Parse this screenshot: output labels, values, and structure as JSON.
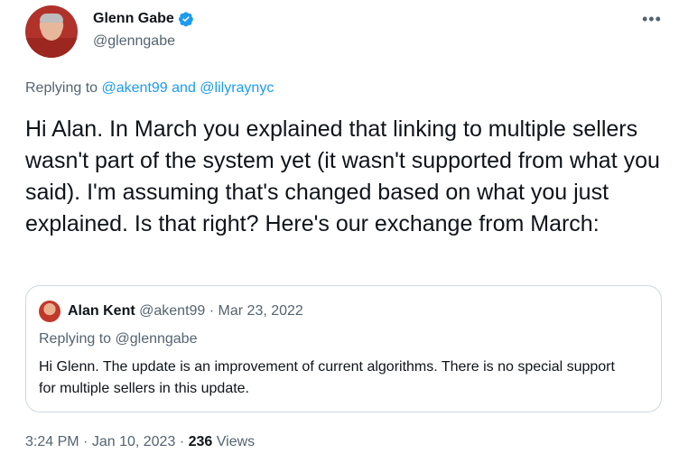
{
  "author": {
    "name": "Glenn Gabe",
    "handle": "@glenngabe",
    "verified_icon": "verified-badge-icon",
    "avatar_icon": "user-avatar"
  },
  "more_icon": "more-horizontal-icon",
  "replying": {
    "prefix": "Replying to",
    "mention1": "@akent99",
    "conjunction": "and",
    "mention2": "@lilyraynyc"
  },
  "tweet_text": "Hi Alan. In March you explained that linking to multiple sellers wasn't part of the system yet (it wasn't supported from what you said). I'm assuming that's changed based on what you just explained. Is that right? Here's our exchange from March:",
  "quote": {
    "name": "Alan Kent",
    "handle": "@akent99",
    "separator": "·",
    "date": "Mar 23, 2022",
    "replying": "Replying to @glenngabe",
    "text": "Hi Glenn. The update is an improvement of current algorithms. There is no special support for multiple sellers in this update."
  },
  "meta": {
    "time": "3:24 PM",
    "separator": "·",
    "date": "Jan 10, 2023",
    "views_count": "236",
    "views_label": "Views"
  },
  "colors": {
    "accent": "#1d9bf0",
    "text": "#0f1419",
    "secondary": "#536471",
    "border": "#cfd9de"
  }
}
